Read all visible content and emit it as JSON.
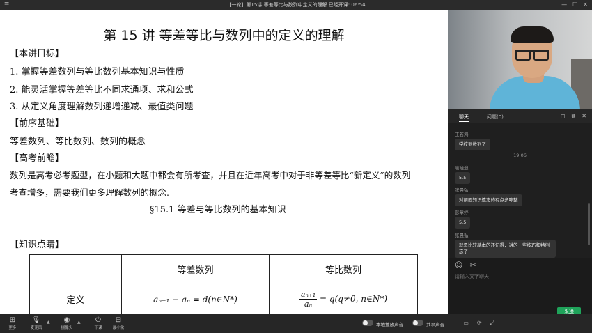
{
  "window": {
    "title": "【一轮】第15讲 等差等比与数列中定义的理解   已经开课: 06:54"
  },
  "slide": {
    "title": "第 15 讲  等差等比与数列中的定义的理解",
    "objectives_heading": "【本讲目标】",
    "objectives": [
      "1.    掌握等差数列与等比数列基本知识与性质",
      "2.    能灵活掌握等差等比不同求通项、求和公式",
      "3.    从定义角度理解数列递增递减、最值类问题"
    ],
    "prereq_heading": "【前序基础】",
    "prereq_text": "等差数列、等比数列、数列的概念",
    "exam_heading": "【高考前瞻】",
    "exam_line1": "数列是高考必考题型，在小题和大题中都会有所考查，并且在近年高考中对于非等差等比“新定义”的数列",
    "exam_line2": "考查增多，需要我们更多理解数列的概念.",
    "section_title": "§15.1  等差与等比数列的基本知识",
    "knowledge_heading": "【知识点睛】",
    "table": {
      "col1_header": "",
      "col2_header": "等差数列",
      "col3_header": "等比数列",
      "row1_label": "定义",
      "arith_def": "aₙ₊₁ − aₙ = d(n∈N*)",
      "geo_num": "aₙ₊₁",
      "geo_den": "aₙ",
      "geo_rest": " = q(q≠0, n∈N*)"
    }
  },
  "chat": {
    "tab_chat": "聊天",
    "tab_questions": "问题(0)",
    "messages": [
      {
        "name": "王若鸿",
        "text": "学校到数列了"
      },
      {
        "time": "19:06"
      },
      {
        "name": "喻晓迪",
        "text": "5.5"
      },
      {
        "name": "张晨弘",
        "text": "对前面知识遗忘的有点多咋整"
      },
      {
        "name": "彭章婷",
        "text": "5.5"
      },
      {
        "name": "张晨弘",
        "text": "就是比较基本的还记得，讲的一些技巧和特例忘了"
      }
    ],
    "input_placeholder": "请输入文字聊天",
    "send_label": "发送"
  },
  "toolbar": {
    "more": "更多",
    "mic": "麦克风",
    "camera": "摄像头",
    "leave": "下课",
    "minimize": "最小化",
    "local_audio": "本地播放声音",
    "share_audio": "共享声音"
  }
}
